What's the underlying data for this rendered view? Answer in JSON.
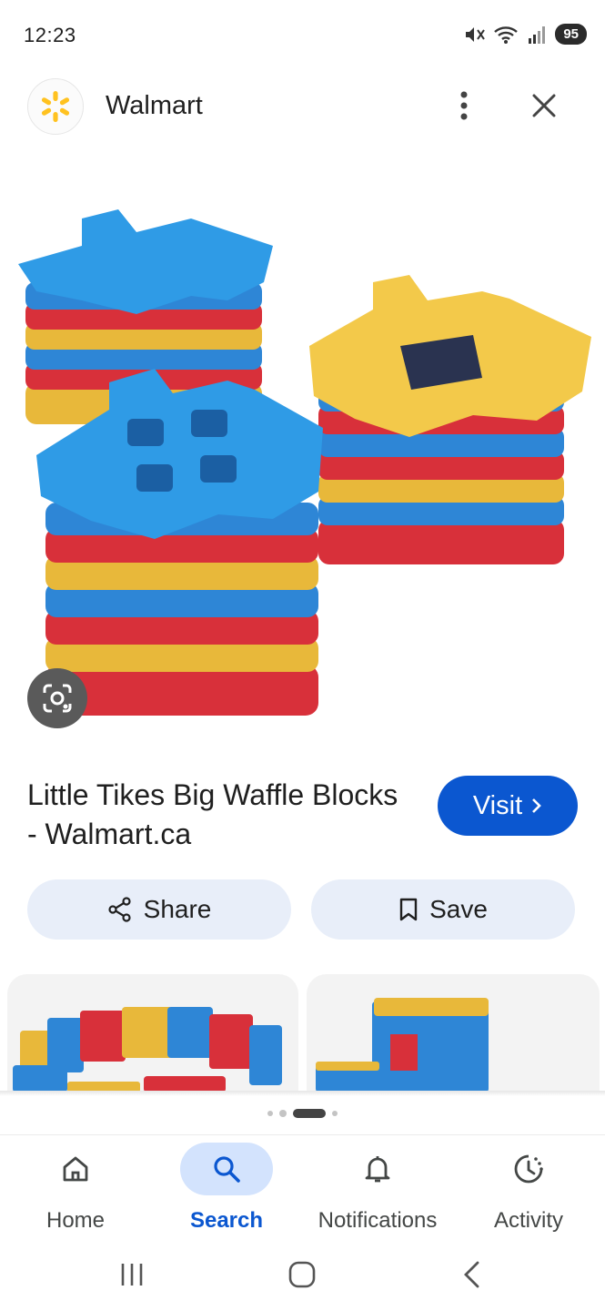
{
  "status_bar": {
    "time": "12:23",
    "battery": "95",
    "icons": [
      "mute-icon",
      "wifi-icon",
      "signal-icon",
      "battery-icon"
    ]
  },
  "header": {
    "site_name": "Walmart",
    "logo_icon": "walmart-spark-icon",
    "brand_color": "#ffc220"
  },
  "product": {
    "title": "Little Tikes Big Waffle Blocks - Walmart.ca",
    "visit_label": "Visit",
    "share_label": "Share",
    "save_label": "Save",
    "accent_color": "#0b57d0"
  },
  "pager": {
    "total": 4,
    "active_index": 2
  },
  "bottom_nav": {
    "items": [
      {
        "label": "Home",
        "icon": "home-icon"
      },
      {
        "label": "Search",
        "icon": "search-icon",
        "active": true
      },
      {
        "label": "Notifications",
        "icon": "bell-icon"
      },
      {
        "label": "Activity",
        "icon": "activity-icon"
      }
    ]
  },
  "system_nav": [
    "recents-icon",
    "home-button-icon",
    "back-icon"
  ]
}
